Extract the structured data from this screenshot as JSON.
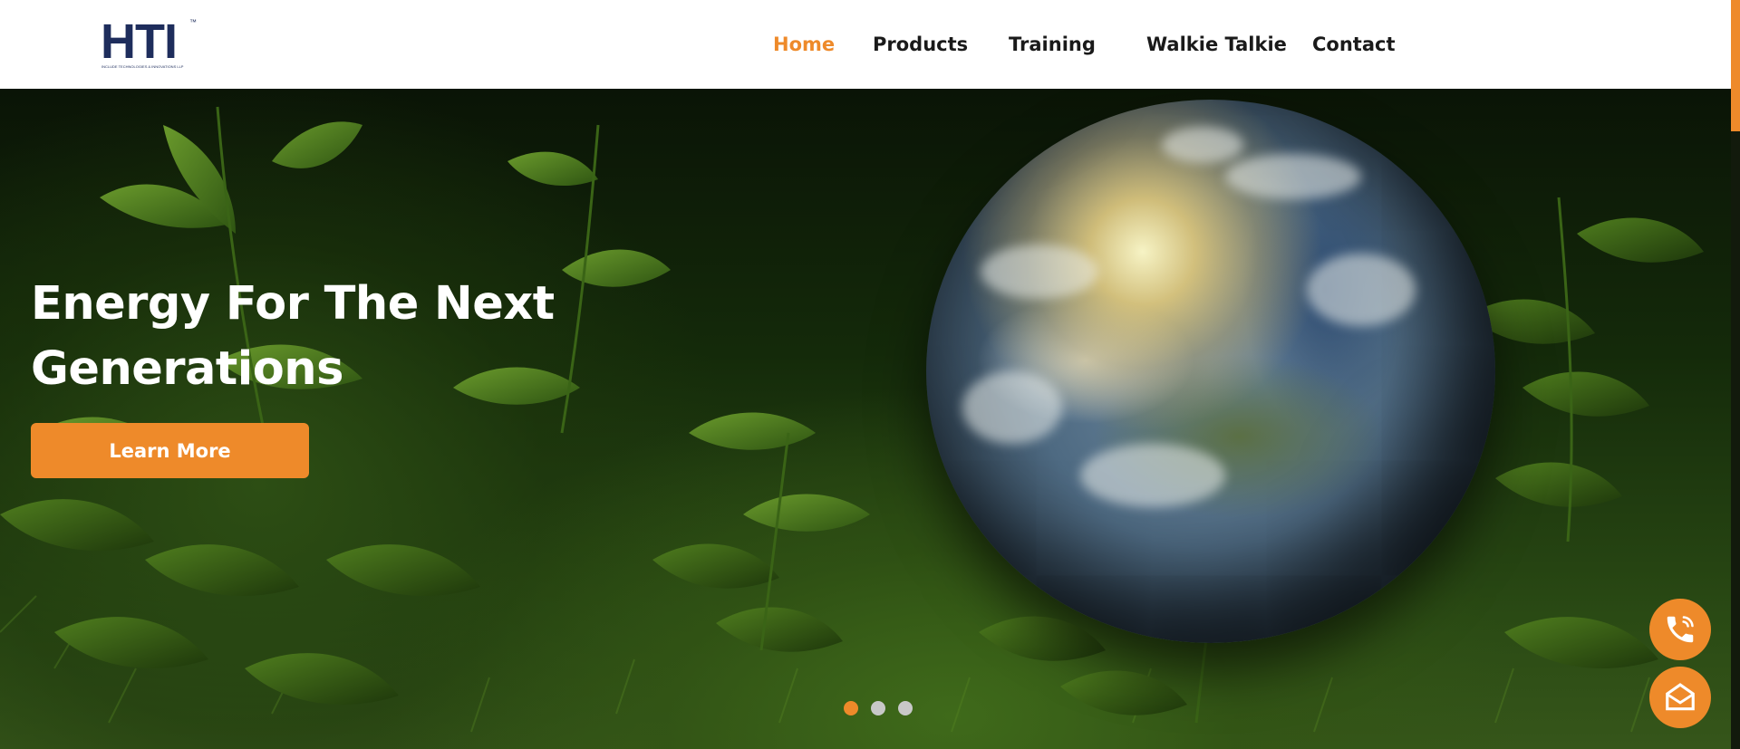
{
  "brand": {
    "logo_text": "HTI",
    "logo_tm": "™",
    "logo_tagline": "INCLUDE TECHNOLOGIES & INNOVATIONS LLP",
    "accent_color": "#ee8a2a",
    "brand_color": "#1e2d5c"
  },
  "nav": {
    "items": [
      {
        "label": "Home",
        "active": true
      },
      {
        "label": "Products",
        "active": false
      },
      {
        "label": "Training",
        "active": false
      },
      {
        "label": "Walkie Talkie",
        "active": false
      },
      {
        "label": "Contact",
        "active": false
      }
    ]
  },
  "hero": {
    "title": "Energy For The Next Generations",
    "button_label": "Learn More",
    "background_image": "globe-in-grass",
    "slides": {
      "count": 3,
      "active_index": 0
    }
  },
  "floating": {
    "call_icon": "phone-icon",
    "mail_icon": "envelope-open-icon"
  }
}
